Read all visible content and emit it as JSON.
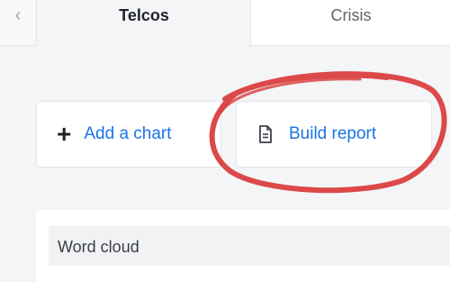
{
  "tabs": {
    "prev_icon": "chevron-left-icon",
    "items": [
      {
        "label": "Telcos",
        "active": true
      },
      {
        "label": "Crisis",
        "active": false
      }
    ]
  },
  "toolbar": {
    "add_chart": {
      "label": "Add a chart",
      "icon": "plus-icon"
    },
    "build_report": {
      "label": "Build report",
      "icon": "document-icon"
    }
  },
  "widget": {
    "title": "Word cloud"
  },
  "annotation": {
    "type": "hand-drawn circle",
    "color": "#d93a3a",
    "target": "build-report-button"
  },
  "colors": {
    "accent": "#1a73e8",
    "marker": "#d93a3a"
  }
}
